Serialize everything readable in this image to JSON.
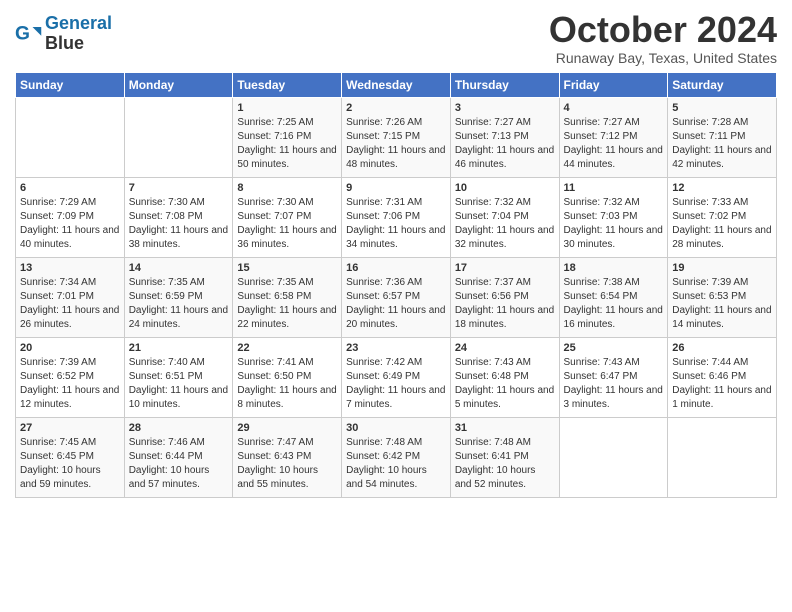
{
  "header": {
    "logo_line1": "General",
    "logo_line2": "Blue",
    "title": "October 2024",
    "subtitle": "Runaway Bay, Texas, United States"
  },
  "days_of_week": [
    "Sunday",
    "Monday",
    "Tuesday",
    "Wednesday",
    "Thursday",
    "Friday",
    "Saturday"
  ],
  "weeks": [
    [
      {
        "day": "",
        "sunrise": "",
        "sunset": "",
        "daylight": ""
      },
      {
        "day": "",
        "sunrise": "",
        "sunset": "",
        "daylight": ""
      },
      {
        "day": "1",
        "sunrise": "Sunrise: 7:25 AM",
        "sunset": "Sunset: 7:16 PM",
        "daylight": "Daylight: 11 hours and 50 minutes."
      },
      {
        "day": "2",
        "sunrise": "Sunrise: 7:26 AM",
        "sunset": "Sunset: 7:15 PM",
        "daylight": "Daylight: 11 hours and 48 minutes."
      },
      {
        "day": "3",
        "sunrise": "Sunrise: 7:27 AM",
        "sunset": "Sunset: 7:13 PM",
        "daylight": "Daylight: 11 hours and 46 minutes."
      },
      {
        "day": "4",
        "sunrise": "Sunrise: 7:27 AM",
        "sunset": "Sunset: 7:12 PM",
        "daylight": "Daylight: 11 hours and 44 minutes."
      },
      {
        "day": "5",
        "sunrise": "Sunrise: 7:28 AM",
        "sunset": "Sunset: 7:11 PM",
        "daylight": "Daylight: 11 hours and 42 minutes."
      }
    ],
    [
      {
        "day": "6",
        "sunrise": "Sunrise: 7:29 AM",
        "sunset": "Sunset: 7:09 PM",
        "daylight": "Daylight: 11 hours and 40 minutes."
      },
      {
        "day": "7",
        "sunrise": "Sunrise: 7:30 AM",
        "sunset": "Sunset: 7:08 PM",
        "daylight": "Daylight: 11 hours and 38 minutes."
      },
      {
        "day": "8",
        "sunrise": "Sunrise: 7:30 AM",
        "sunset": "Sunset: 7:07 PM",
        "daylight": "Daylight: 11 hours and 36 minutes."
      },
      {
        "day": "9",
        "sunrise": "Sunrise: 7:31 AM",
        "sunset": "Sunset: 7:06 PM",
        "daylight": "Daylight: 11 hours and 34 minutes."
      },
      {
        "day": "10",
        "sunrise": "Sunrise: 7:32 AM",
        "sunset": "Sunset: 7:04 PM",
        "daylight": "Daylight: 11 hours and 32 minutes."
      },
      {
        "day": "11",
        "sunrise": "Sunrise: 7:32 AM",
        "sunset": "Sunset: 7:03 PM",
        "daylight": "Daylight: 11 hours and 30 minutes."
      },
      {
        "day": "12",
        "sunrise": "Sunrise: 7:33 AM",
        "sunset": "Sunset: 7:02 PM",
        "daylight": "Daylight: 11 hours and 28 minutes."
      }
    ],
    [
      {
        "day": "13",
        "sunrise": "Sunrise: 7:34 AM",
        "sunset": "Sunset: 7:01 PM",
        "daylight": "Daylight: 11 hours and 26 minutes."
      },
      {
        "day": "14",
        "sunrise": "Sunrise: 7:35 AM",
        "sunset": "Sunset: 6:59 PM",
        "daylight": "Daylight: 11 hours and 24 minutes."
      },
      {
        "day": "15",
        "sunrise": "Sunrise: 7:35 AM",
        "sunset": "Sunset: 6:58 PM",
        "daylight": "Daylight: 11 hours and 22 minutes."
      },
      {
        "day": "16",
        "sunrise": "Sunrise: 7:36 AM",
        "sunset": "Sunset: 6:57 PM",
        "daylight": "Daylight: 11 hours and 20 minutes."
      },
      {
        "day": "17",
        "sunrise": "Sunrise: 7:37 AM",
        "sunset": "Sunset: 6:56 PM",
        "daylight": "Daylight: 11 hours and 18 minutes."
      },
      {
        "day": "18",
        "sunrise": "Sunrise: 7:38 AM",
        "sunset": "Sunset: 6:54 PM",
        "daylight": "Daylight: 11 hours and 16 minutes."
      },
      {
        "day": "19",
        "sunrise": "Sunrise: 7:39 AM",
        "sunset": "Sunset: 6:53 PM",
        "daylight": "Daylight: 11 hours and 14 minutes."
      }
    ],
    [
      {
        "day": "20",
        "sunrise": "Sunrise: 7:39 AM",
        "sunset": "Sunset: 6:52 PM",
        "daylight": "Daylight: 11 hours and 12 minutes."
      },
      {
        "day": "21",
        "sunrise": "Sunrise: 7:40 AM",
        "sunset": "Sunset: 6:51 PM",
        "daylight": "Daylight: 11 hours and 10 minutes."
      },
      {
        "day": "22",
        "sunrise": "Sunrise: 7:41 AM",
        "sunset": "Sunset: 6:50 PM",
        "daylight": "Daylight: 11 hours and 8 minutes."
      },
      {
        "day": "23",
        "sunrise": "Sunrise: 7:42 AM",
        "sunset": "Sunset: 6:49 PM",
        "daylight": "Daylight: 11 hours and 7 minutes."
      },
      {
        "day": "24",
        "sunrise": "Sunrise: 7:43 AM",
        "sunset": "Sunset: 6:48 PM",
        "daylight": "Daylight: 11 hours and 5 minutes."
      },
      {
        "day": "25",
        "sunrise": "Sunrise: 7:43 AM",
        "sunset": "Sunset: 6:47 PM",
        "daylight": "Daylight: 11 hours and 3 minutes."
      },
      {
        "day": "26",
        "sunrise": "Sunrise: 7:44 AM",
        "sunset": "Sunset: 6:46 PM",
        "daylight": "Daylight: 11 hours and 1 minute."
      }
    ],
    [
      {
        "day": "27",
        "sunrise": "Sunrise: 7:45 AM",
        "sunset": "Sunset: 6:45 PM",
        "daylight": "Daylight: 10 hours and 59 minutes."
      },
      {
        "day": "28",
        "sunrise": "Sunrise: 7:46 AM",
        "sunset": "Sunset: 6:44 PM",
        "daylight": "Daylight: 10 hours and 57 minutes."
      },
      {
        "day": "29",
        "sunrise": "Sunrise: 7:47 AM",
        "sunset": "Sunset: 6:43 PM",
        "daylight": "Daylight: 10 hours and 55 minutes."
      },
      {
        "day": "30",
        "sunrise": "Sunrise: 7:48 AM",
        "sunset": "Sunset: 6:42 PM",
        "daylight": "Daylight: 10 hours and 54 minutes."
      },
      {
        "day": "31",
        "sunrise": "Sunrise: 7:48 AM",
        "sunset": "Sunset: 6:41 PM",
        "daylight": "Daylight: 10 hours and 52 minutes."
      },
      {
        "day": "",
        "sunrise": "",
        "sunset": "",
        "daylight": ""
      },
      {
        "day": "",
        "sunrise": "",
        "sunset": "",
        "daylight": ""
      }
    ]
  ]
}
